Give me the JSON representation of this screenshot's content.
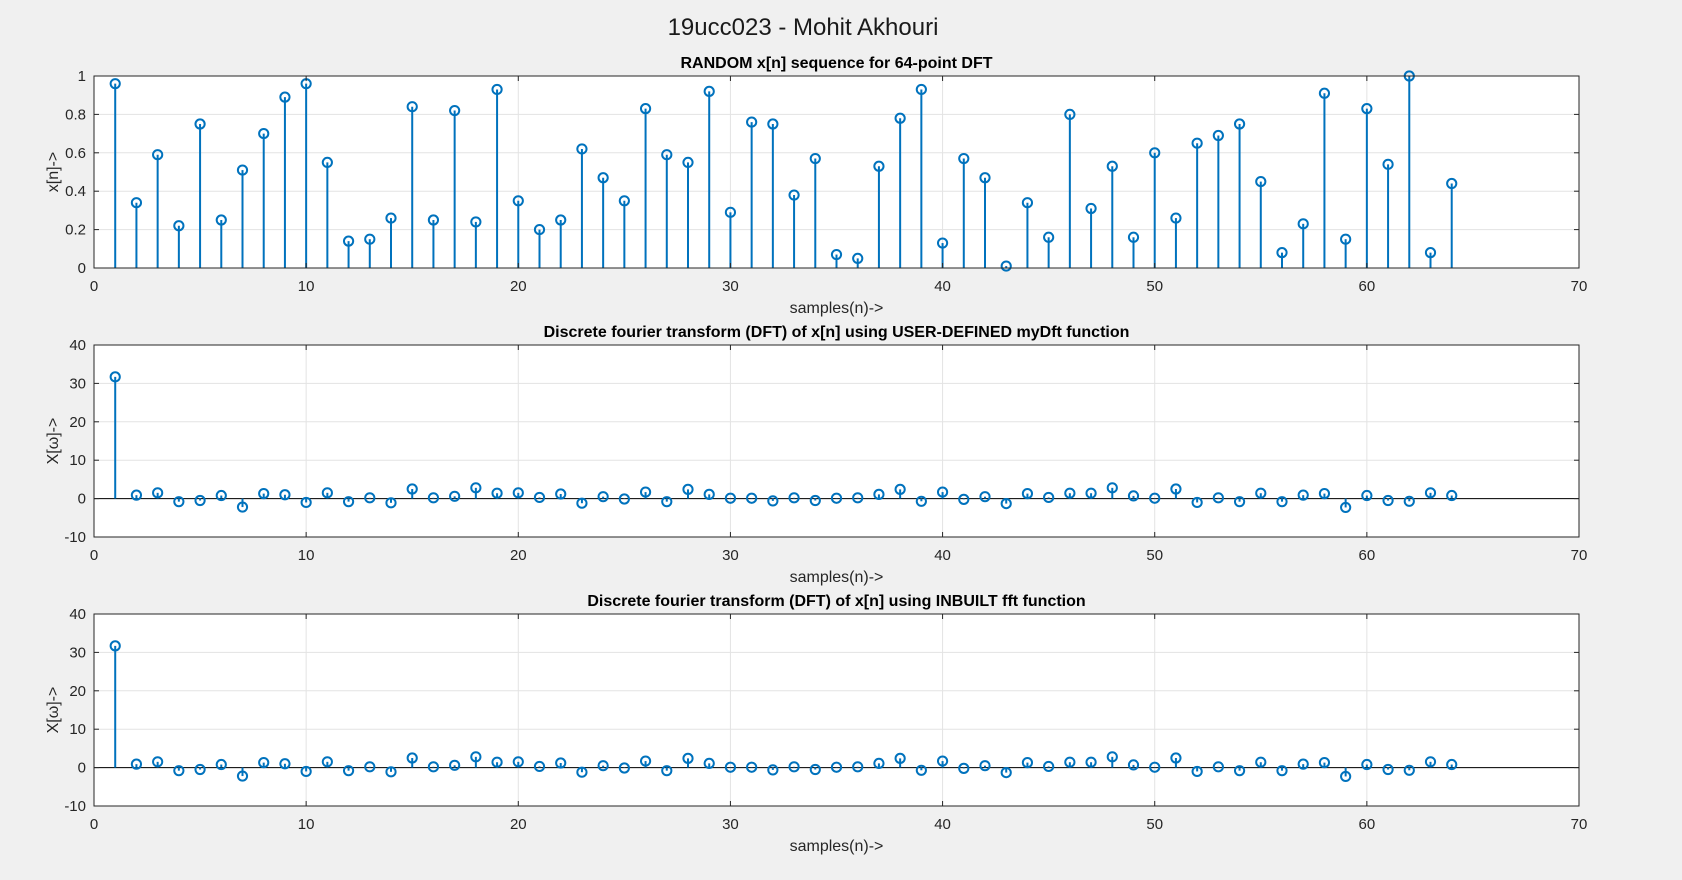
{
  "figure": {
    "suptitle": "19ucc023 - Mohit Akhouri",
    "background": "#f0f0f0",
    "stem_color": "#0072bd"
  },
  "chart_data": [
    {
      "type": "stem",
      "title": "RANDOM x[n] sequence for 64-point DFT",
      "xlabel": "samples(n)->",
      "ylabel": "x[n]->",
      "xlim": [
        0,
        70
      ],
      "ylim": [
        0,
        1
      ],
      "xticks": [
        0,
        10,
        20,
        30,
        40,
        50,
        60,
        70
      ],
      "yticks": [
        0,
        0.2,
        0.4,
        0.6,
        0.8,
        1
      ],
      "ytick_labels": [
        "0",
        "0.2",
        "0.4",
        "0.6",
        "0.8",
        "1"
      ],
      "grid": true,
      "zero_line": false,
      "x": [
        1,
        2,
        3,
        4,
        5,
        6,
        7,
        8,
        9,
        10,
        11,
        12,
        13,
        14,
        15,
        16,
        17,
        18,
        19,
        20,
        21,
        22,
        23,
        24,
        25,
        26,
        27,
        28,
        29,
        30,
        31,
        32,
        33,
        34,
        35,
        36,
        37,
        38,
        39,
        40,
        41,
        42,
        43,
        44,
        45,
        46,
        47,
        48,
        49,
        50,
        51,
        52,
        53,
        54,
        55,
        56,
        57,
        58,
        59,
        60,
        61,
        62,
        63,
        64
      ],
      "values": [
        0.96,
        0.34,
        0.59,
        0.22,
        0.75,
        0.25,
        0.51,
        0.7,
        0.89,
        0.96,
        0.55,
        0.14,
        0.15,
        0.26,
        0.84,
        0.25,
        0.82,
        0.24,
        0.93,
        0.35,
        0.2,
        0.25,
        0.62,
        0.47,
        0.35,
        0.83,
        0.59,
        0.55,
        0.92,
        0.29,
        0.76,
        0.75,
        0.38,
        0.57,
        0.07,
        0.05,
        0.53,
        0.78,
        0.93,
        0.13,
        0.57,
        0.47,
        0.01,
        0.34,
        0.16,
        0.8,
        0.31,
        0.53,
        0.16,
        0.6,
        0.26,
        0.65,
        0.69,
        0.75,
        0.45,
        0.08,
        0.23,
        0.91,
        0.15,
        0.83,
        0.54,
        1.0,
        0.08,
        0.44
      ]
    },
    {
      "type": "stem",
      "title": "Discrete fourier transform (DFT) of x[n] using USER-DEFINED myDft function",
      "xlabel": "samples(n)->",
      "ylabel": "X[ω]->",
      "xlim": [
        0,
        70
      ],
      "ylim": [
        -10,
        40
      ],
      "xticks": [
        0,
        10,
        20,
        30,
        40,
        50,
        60,
        70
      ],
      "yticks": [
        -10,
        0,
        10,
        20,
        30,
        40
      ],
      "ytick_labels": [
        "-10",
        "0",
        "10",
        "20",
        "30",
        "40"
      ],
      "grid": true,
      "zero_line": true,
      "x": [
        1,
        2,
        3,
        4,
        5,
        6,
        7,
        8,
        9,
        10,
        11,
        12,
        13,
        14,
        15,
        16,
        17,
        18,
        19,
        20,
        21,
        22,
        23,
        24,
        25,
        26,
        27,
        28,
        29,
        30,
        31,
        32,
        33,
        34,
        35,
        36,
        37,
        38,
        39,
        40,
        41,
        42,
        43,
        44,
        45,
        46,
        47,
        48,
        49,
        50,
        51,
        52,
        53,
        54,
        55,
        56,
        57,
        58,
        59,
        60,
        61,
        62,
        63,
        64
      ],
      "values": [
        31.7,
        0.9,
        1.5,
        -0.8,
        -0.5,
        0.8,
        -2.2,
        1.3,
        1.0,
        -1.0,
        1.5,
        -0.8,
        0.2,
        -1.1,
        2.5,
        0.2,
        0.6,
        2.8,
        1.4,
        1.5,
        0.3,
        1.2,
        -1.2,
        0.5,
        -0.1,
        1.7,
        -0.8,
        2.4,
        1.1,
        0.1,
        0.1,
        -0.6,
        0.2,
        -0.5,
        0.1,
        0.2,
        1.1,
        2.4,
        -0.7,
        1.7,
        -0.2,
        0.5,
        -1.3,
        1.3,
        0.3,
        1.4,
        1.4,
        2.8,
        0.7,
        0.1,
        2.5,
        -1.0,
        0.2,
        -0.8,
        1.4,
        -0.8,
        0.9,
        1.3,
        -2.3,
        0.8,
        -0.5,
        -0.7,
        1.5,
        0.8
      ]
    },
    {
      "type": "stem",
      "title": "Discrete fourier transform (DFT) of x[n] using INBUILT fft function",
      "xlabel": "samples(n)->",
      "ylabel": "X[ω]->",
      "xlim": [
        0,
        70
      ],
      "ylim": [
        -10,
        40
      ],
      "xticks": [
        0,
        10,
        20,
        30,
        40,
        50,
        60,
        70
      ],
      "yticks": [
        -10,
        0,
        10,
        20,
        30,
        40
      ],
      "ytick_labels": [
        "-10",
        "0",
        "10",
        "20",
        "30",
        "40"
      ],
      "grid": true,
      "zero_line": true,
      "x": [
        1,
        2,
        3,
        4,
        5,
        6,
        7,
        8,
        9,
        10,
        11,
        12,
        13,
        14,
        15,
        16,
        17,
        18,
        19,
        20,
        21,
        22,
        23,
        24,
        25,
        26,
        27,
        28,
        29,
        30,
        31,
        32,
        33,
        34,
        35,
        36,
        37,
        38,
        39,
        40,
        41,
        42,
        43,
        44,
        45,
        46,
        47,
        48,
        49,
        50,
        51,
        52,
        53,
        54,
        55,
        56,
        57,
        58,
        59,
        60,
        61,
        62,
        63,
        64
      ],
      "values": [
        31.7,
        0.9,
        1.5,
        -0.8,
        -0.5,
        0.8,
        -2.2,
        1.3,
        1.0,
        -1.0,
        1.5,
        -0.8,
        0.2,
        -1.1,
        2.5,
        0.2,
        0.6,
        2.8,
        1.4,
        1.5,
        0.3,
        1.2,
        -1.2,
        0.5,
        -0.1,
        1.7,
        -0.8,
        2.4,
        1.1,
        0.1,
        0.1,
        -0.6,
        0.2,
        -0.5,
        0.1,
        0.2,
        1.1,
        2.4,
        -0.7,
        1.7,
        -0.2,
        0.5,
        -1.3,
        1.3,
        0.3,
        1.4,
        1.4,
        2.8,
        0.7,
        0.1,
        2.5,
        -1.0,
        0.2,
        -0.8,
        1.4,
        -0.8,
        0.9,
        1.3,
        -2.3,
        0.8,
        -0.5,
        -0.7,
        1.5,
        0.8
      ]
    }
  ]
}
